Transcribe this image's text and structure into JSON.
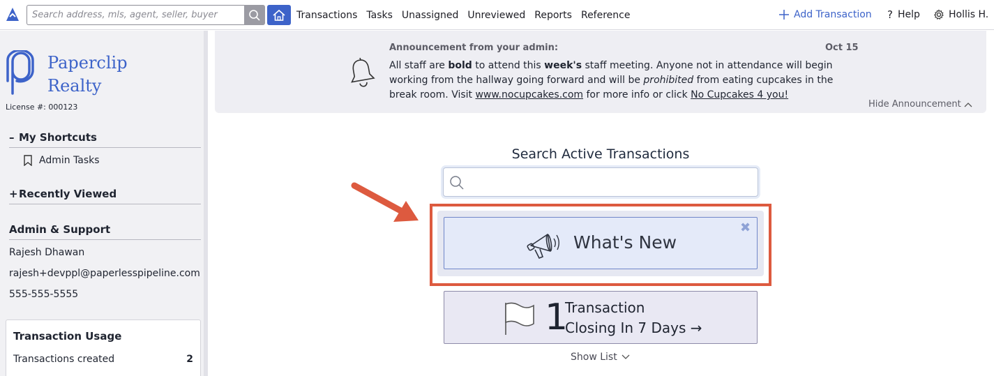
{
  "topbar": {
    "search_placeholder": "Search address, mls, agent, seller, buyer",
    "nav": [
      "Transactions",
      "Tasks",
      "Unassigned",
      "Unreviewed",
      "Reports",
      "Reference"
    ],
    "add_transaction": "Add Transaction",
    "help": "Help",
    "user": "Hollis H.",
    "accent_color": "#3d63c9"
  },
  "sidebar": {
    "brand_line1": "Paperclip",
    "brand_line2": "Realty",
    "license": "License #: 000123",
    "shortcuts_heading": "My Shortcuts",
    "shortcuts_sign": "–",
    "shortcut_item": "Admin Tasks",
    "recent_heading": "Recently Viewed",
    "recent_sign": "+",
    "admin_heading": "Admin & Support",
    "admin_name": "Rajesh Dhawan",
    "admin_email": "rajesh+devppl@paperlesspipeline.com",
    "admin_phone": "555-555-5555",
    "usage_title": "Transaction Usage",
    "usage_label": "Transactions created",
    "usage_value": "2"
  },
  "announcement": {
    "title": "Announcement from your admin:",
    "date": "Oct 15",
    "body_part1": "All staff are ",
    "body_bold1": "bold",
    "body_part2": " to attend this ",
    "body_bold2": "week's",
    "body_part3": " staff meeting. Anyone not in attendance will begin working from the hallway going forward and will be ",
    "body_italic": "prohibited",
    "body_part4": " from eating cupcakes in the break room. Visit ",
    "body_link1": "www.nocupcakes.com",
    "body_part5": " for more info or click ",
    "body_link2": "No Cupcakes 4 you!",
    "hide_label": "Hide Announcement"
  },
  "main": {
    "search_title": "Search Active Transactions",
    "whats_new": "What's New",
    "close_glyph": "✖",
    "closing_count": "1",
    "closing_line1": "Transaction",
    "closing_line2": "Closing In 7 Days →",
    "show_list": "Show List",
    "highlight_color": "#dd5a3f"
  }
}
